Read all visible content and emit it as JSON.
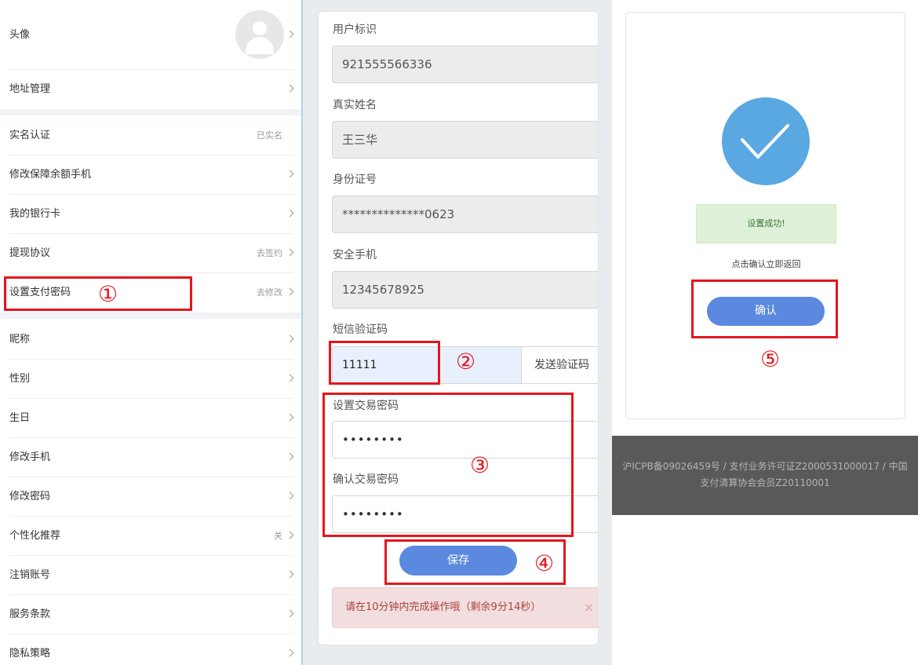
{
  "left_menu": {
    "avatar_label": "头像",
    "address": "地址管理",
    "realname": "实名认证",
    "realname_status": "已实名",
    "change_guarantee_phone": "修改保障余额手机",
    "bank_card": "我的银行卡",
    "withdraw_agreement": "提现协议",
    "withdraw_agreement_action": "去签约",
    "set_pay_password": "设置支付密码",
    "set_pay_password_action": "去修改",
    "nickname": "昵称",
    "gender": "性别",
    "birthday": "生日",
    "change_phone": "修改手机",
    "change_password": "修改密码",
    "personalized_recommend": "个性化推荐",
    "personalized_recommend_status": "关",
    "cancel_account": "注销账号",
    "terms": "服务条款",
    "privacy": "隐私策略"
  },
  "form": {
    "user_id_label": "用户标识",
    "user_id_value": "921555566336",
    "real_name_label": "真实姓名",
    "real_name_value": "王三华",
    "id_number_label": "身份证号",
    "id_number_value": "**************0623",
    "secure_phone_label": "安全手机",
    "secure_phone_value": "12345678925",
    "sms_code_label": "短信验证码",
    "sms_code_value": "11111",
    "send_code_button": "发送验证码",
    "trade_password_label": "设置交易密码",
    "trade_password_value": "••••••••",
    "confirm_trade_password_label": "确认交易密码",
    "confirm_trade_password_value": "••••••••",
    "save_button": "保存",
    "alert_text": "请在10分钟内完成操作哦（剩余9分14秒）",
    "alert_close": "×"
  },
  "result": {
    "success_text": "设置成功!",
    "hint_text": "点击确认立即返回",
    "confirm_button": "确认"
  },
  "footer": {
    "text": "沪ICPB备09026459号 / 支付业务许可证Z2000531000017 / 中国支付清算协会会员Z20110001"
  },
  "annotations": {
    "step1": "①",
    "step2": "②",
    "step3": "③",
    "step4": "④",
    "step5": "⑤"
  },
  "colors": {
    "accent_blue": "#5a89df",
    "check_blue": "#5aa8e2",
    "annotation_red": "#e3161e",
    "success_bg": "#dff0d8",
    "alert_bg": "#f2dede"
  }
}
